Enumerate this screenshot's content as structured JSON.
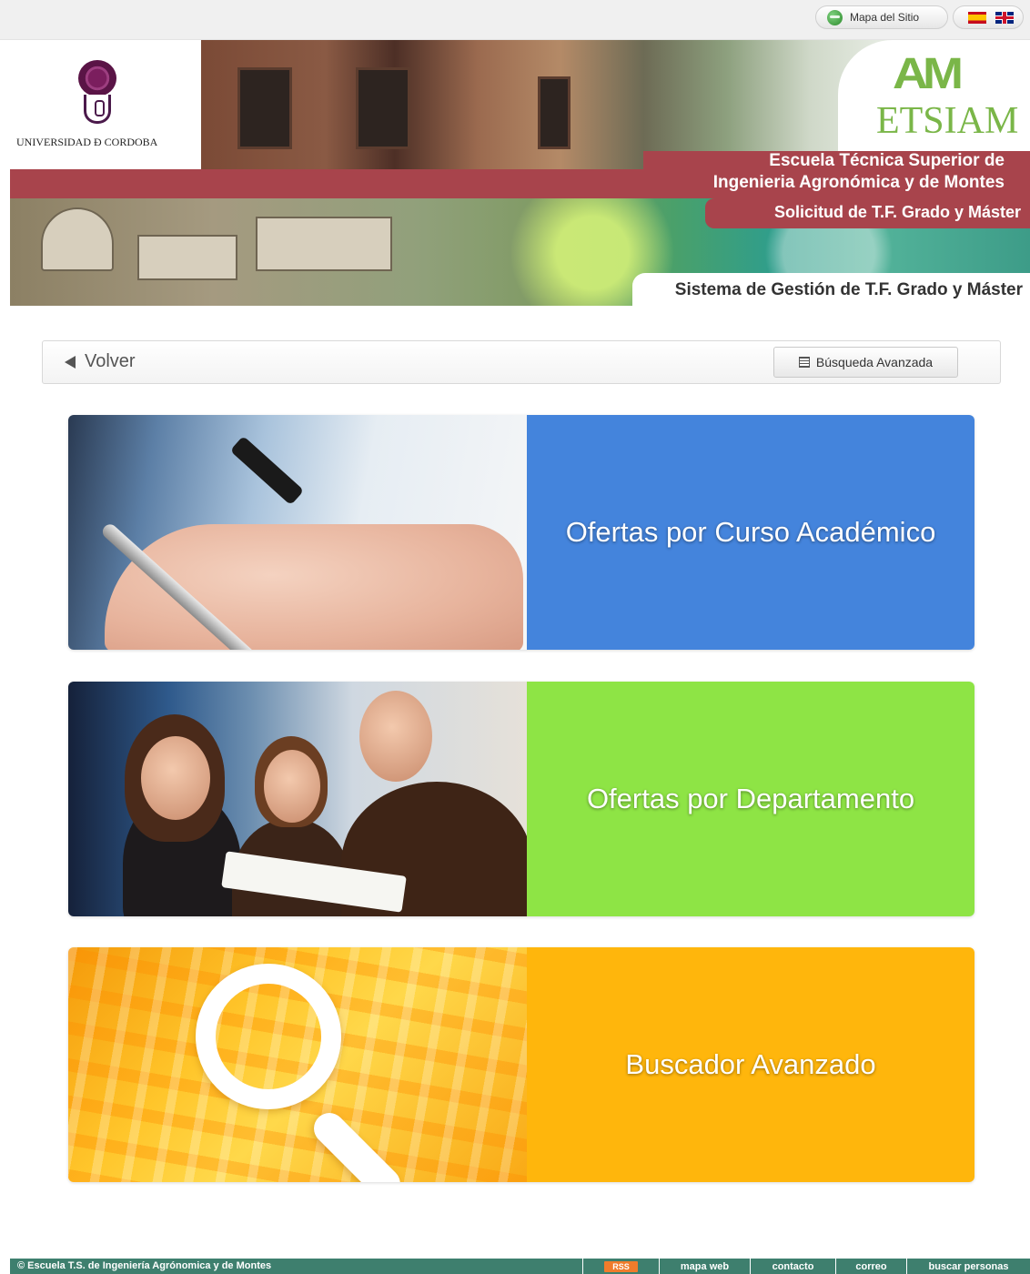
{
  "topbar": {
    "sitemap_label": "Mapa del Sitio",
    "sitemap_icon": "globe-icon",
    "languages": [
      "spanish-flag-icon",
      "uk-flag-icon"
    ]
  },
  "header": {
    "university_name": "UNIVERSIDAD Ð CORDOBA",
    "school_logo_mark": "AM",
    "school_logo_text": "ETSIAM",
    "school_title_line1": "Escuela Técnica Superior de",
    "school_title_line2": "Ingenieria Agronómica y de Montes",
    "subtitle": "Solicitud de T.F. Grado y Máster",
    "system_title": "Sistema de Gestión de T.F. Grado y Máster"
  },
  "toolbar": {
    "back_label": "Volver",
    "advanced_search_label": "Búsqueda Avanzada"
  },
  "cards": [
    {
      "label": "Ofertas por Curso Académico",
      "color": "#4484dc"
    },
    {
      "label": "Ofertas por Departamento",
      "color": "#8ee445"
    },
    {
      "label": "Buscador Avanzado",
      "color": "#ffb60c"
    }
  ],
  "footer": {
    "copyright": "© Escuela T.S. de Ingeniería Agrónomica y de Montes",
    "rss_label": "RSS",
    "links": [
      "mapa web",
      "contacto",
      "correo",
      "buscar personas"
    ],
    "color": "#3e7f6e"
  }
}
